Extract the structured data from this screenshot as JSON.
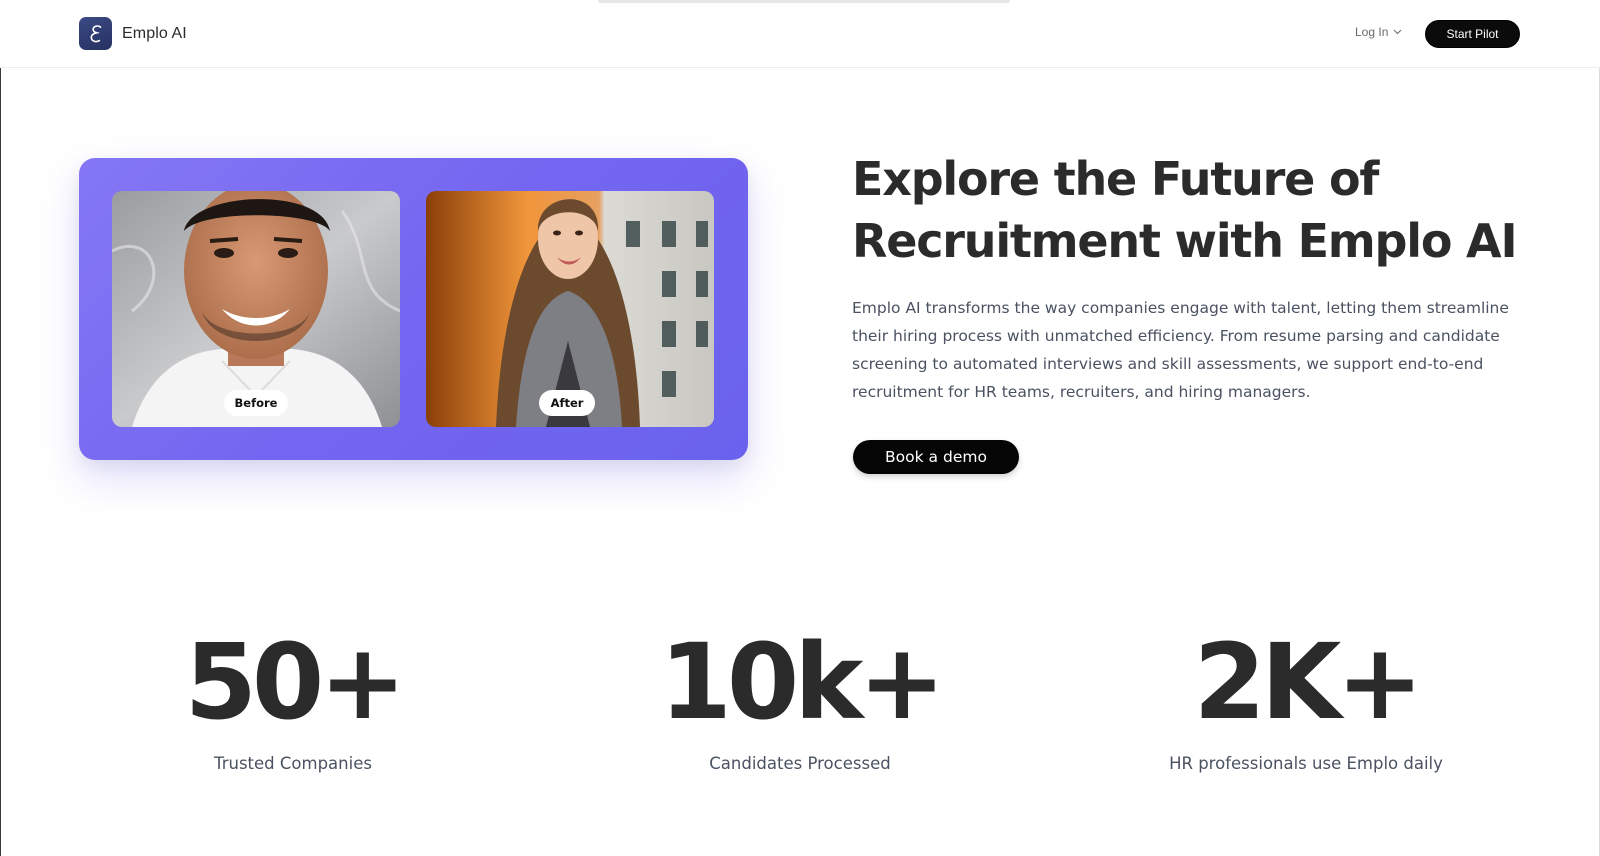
{
  "header": {
    "brand_name": "Emplo AI",
    "logo_icon": "script-e-logo-icon",
    "login_label": "Log In",
    "login_icon": "chevron-down-icon",
    "cta_label": "Start Pilot"
  },
  "hero": {
    "title_line1": "Explore the Future of",
    "title_line2": "Recruitment with Emplo AI",
    "description": "Emplo AI transforms the way companies engage with talent, letting them streamline their hiring process with unmatched efficiency. From resume parsing and candidate screening to automated interviews and skill assessments, we support end-to-end recruitment for HR teams, recruiters, and hiring managers.",
    "demo_button": "Book a demo",
    "card": {
      "before_label": "Before",
      "after_label": "After"
    }
  },
  "stats": [
    {
      "value": "50+",
      "label": "Trusted Companies"
    },
    {
      "value": "10k+",
      "label": "Candidates Processed"
    },
    {
      "value": "2K+",
      "label": "HR professionals use Emplo daily"
    }
  ],
  "colors": {
    "card_accent": "#7466f0",
    "logo_bg": "#2f3b72",
    "button_bg": "#0b0b0b",
    "heading_text": "#2b2b2b",
    "body_text": "#4a5262"
  }
}
